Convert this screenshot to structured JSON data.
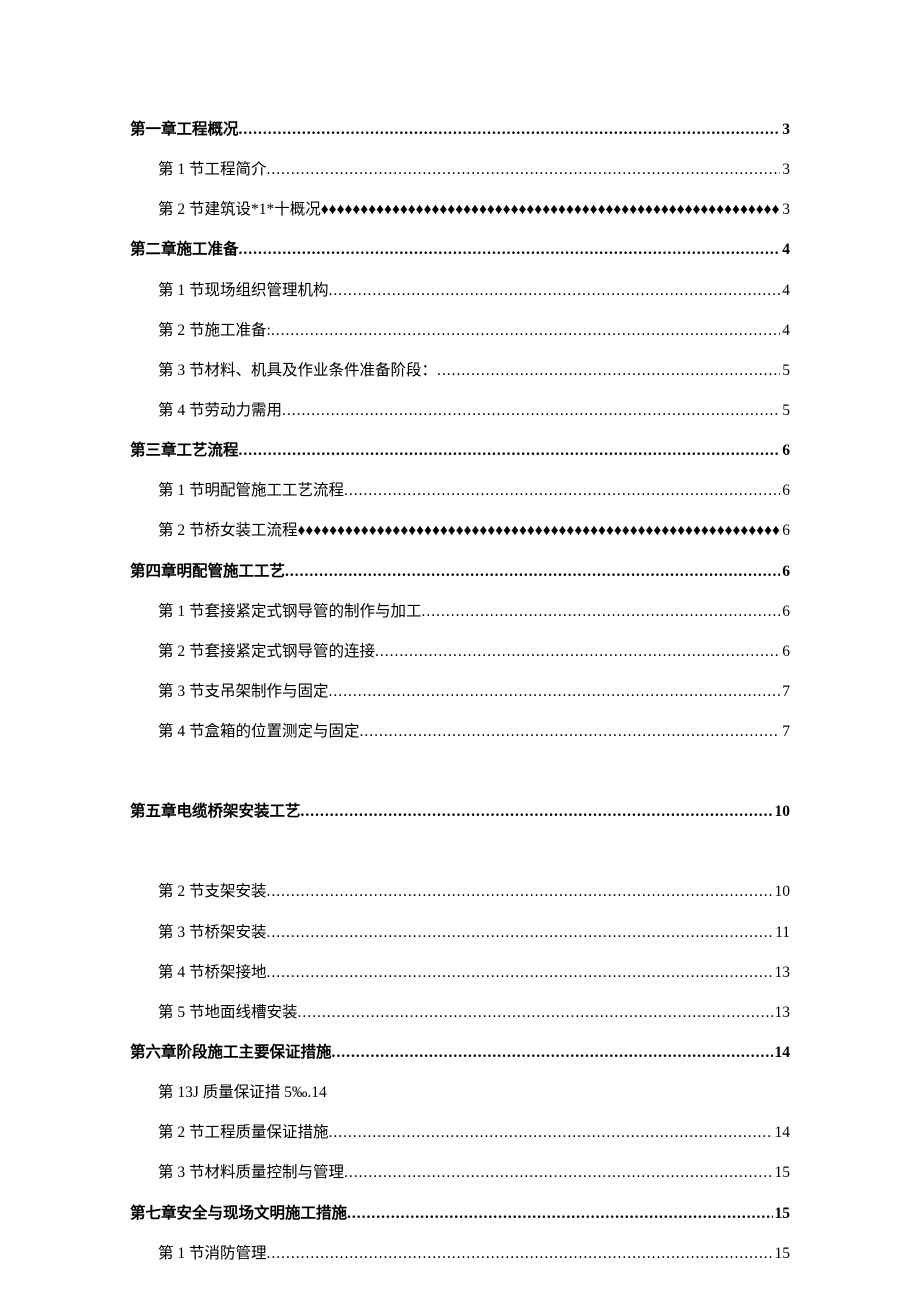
{
  "toc": [
    {
      "level": 1,
      "text": "第一章工程概况",
      "page": "3",
      "leader": "dot"
    },
    {
      "level": 2,
      "text": "第 1 节工程简介",
      "page": "3",
      "leader": "dot"
    },
    {
      "level": 2,
      "text": "第 2 节建筑设*1*十概况",
      "page": "3",
      "leader": "diamond"
    },
    {
      "level": 1,
      "text": "第二章施工准备",
      "page": "4",
      "leader": "dot"
    },
    {
      "level": 2,
      "text": "第 1 节现场组织管理机构",
      "page": "4",
      "leader": "dot"
    },
    {
      "level": 2,
      "text": "第 2 节施工准备:",
      "page": "4",
      "leader": "dot"
    },
    {
      "level": 2,
      "text": "第 3 节材料、机具及作业条件准备阶段：",
      "page": "5",
      "leader": "dot"
    },
    {
      "level": 2,
      "text": "第 4 节劳动力需用",
      "page": "5",
      "leader": "dot"
    },
    {
      "level": 1,
      "text": "第三章工艺流程",
      "page": "6",
      "leader": "dot"
    },
    {
      "level": 2,
      "text": "第 1 节明配管施工工艺流程",
      "page": "6",
      "leader": "dot"
    },
    {
      "level": 2,
      "text": "第 2 节桥女装工流程",
      "page": "6",
      "leader": "diamond"
    },
    {
      "level": 1,
      "text": "第四章明配管施工工艺",
      "page": "6",
      "leader": "dot"
    },
    {
      "level": 2,
      "text": "第 1 节套接紧定式钢导管的制作与加工",
      "page": "6",
      "leader": "dot"
    },
    {
      "level": 2,
      "text": "第 2 节套接紧定式钢导管的连接",
      "page": "6",
      "leader": "dot"
    },
    {
      "level": 2,
      "text": "第 3 节支吊架制作与固定",
      "page": "7",
      "leader": "dot"
    },
    {
      "level": 2,
      "text": "第 4 节盒箱的位置测定与固定",
      "page": "7",
      "leader": "dot"
    },
    {
      "level": 0,
      "gap": true
    },
    {
      "level": 1,
      "text": "第五章电缆桥架安装工艺",
      "page": "10",
      "leader": "dot"
    },
    {
      "level": 0,
      "gap": true
    },
    {
      "level": 2,
      "text": "第 2 节支架安装",
      "page": "10",
      "leader": "dot"
    },
    {
      "level": 2,
      "text": "第 3 节桥架安装",
      "page": "11",
      "leader": "dot"
    },
    {
      "level": 2,
      "text": "第 4 节桥架接地",
      "page": "13",
      "leader": "dot"
    },
    {
      "level": 2,
      "text": "第 5 节地面线槽安装",
      "page": "13",
      "leader": "dot"
    },
    {
      "level": 1,
      "text": "第六章阶段施工主要保证措施",
      "page": "14",
      "leader": "dot"
    },
    {
      "level": 2,
      "text": "第 13J 质量保证措 5‰.14",
      "page": "",
      "leader": "none"
    },
    {
      "level": 2,
      "text": "第 2 节工程质量保证措施",
      "page": "14",
      "leader": "dot"
    },
    {
      "level": 2,
      "text": "第 3 节材料质量控制与管理",
      "page": "15",
      "leader": "dot"
    },
    {
      "level": 1,
      "text": "第七章安全与现场文明施工措施",
      "page": "15",
      "leader": "dot"
    },
    {
      "level": 2,
      "text": "第 1 节消防管理",
      "page": "15",
      "leader": "dot"
    }
  ]
}
